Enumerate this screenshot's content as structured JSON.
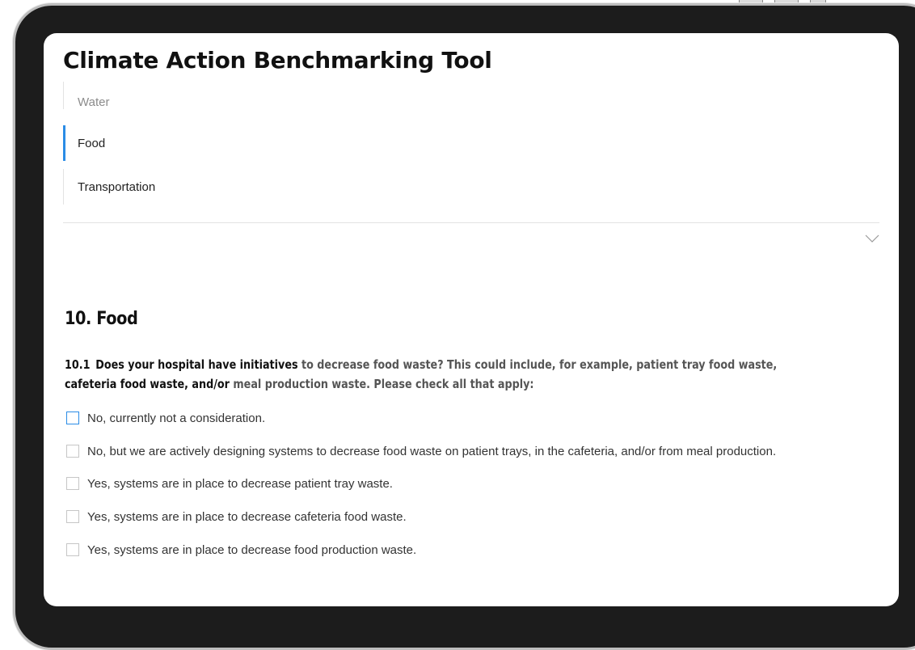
{
  "app": {
    "title": "Climate Action Benchmarking Tool"
  },
  "nav": {
    "items": [
      {
        "label": "Water",
        "state": "previous"
      },
      {
        "label": "Food",
        "state": "active"
      },
      {
        "label": "Transportation",
        "state": "next"
      }
    ],
    "expand_icon": "chevron-down-icon"
  },
  "section": {
    "title": "10. Food",
    "question": {
      "number": "10.1",
      "text_part1": "Does your hospital have initiatives",
      "text_part2": " to decrease food waste? This could include, for example, patient tray food waste, ",
      "text_part3": "cafeteria food waste, and/or",
      "text_part4": " meal production waste. Please check all that apply:"
    },
    "options": [
      {
        "label": "No, currently not a consideration.",
        "checked": false,
        "focused": true
      },
      {
        "label": "No, but we are actively designing systems to decrease food waste on patient trays, in the cafeteria, and/or from meal production.",
        "checked": false,
        "focused": false
      },
      {
        "label": "Yes, systems are in place to decrease patient tray waste.",
        "checked": false,
        "focused": false
      },
      {
        "label": "Yes, systems are in place to decrease cafeteria food waste.",
        "checked": false,
        "focused": false
      },
      {
        "label": "Yes, systems are in place to decrease food production waste.",
        "checked": false,
        "focused": false
      }
    ]
  },
  "colors": {
    "accent": "#2b8ce6",
    "bezel": "#1c1c1c",
    "text_primary": "#111111",
    "text_muted": "#8c8c8c"
  }
}
